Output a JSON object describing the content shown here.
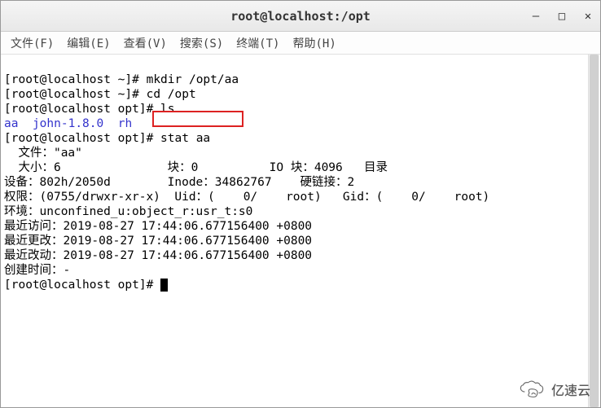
{
  "window": {
    "title": "root@localhost:/opt",
    "controls": {
      "minimize": "—",
      "maximize": "□",
      "close": "✕"
    }
  },
  "menubar": {
    "items": [
      "文件(F)",
      "编辑(E)",
      "查看(V)",
      "搜索(S)",
      "终端(T)",
      "帮助(H)"
    ]
  },
  "terminal": {
    "lines": [
      "[root@localhost ~]# mkdir /opt/aa",
      "[root@localhost ~]# cd /opt",
      "[root@localhost opt]# ls"
    ],
    "ls_output": {
      "aa": "aa",
      "john": "john-1.8.0",
      "rh": "rh"
    },
    "line_stat": "[root@localhost opt]# stat aa",
    "stat_output": [
      "  文件：\"aa\"",
      "  大小：6               块：0          IO 块：4096   目录",
      "设备：802h/2050d        Inode：34862767    硬链接：2",
      "权限：(0755/drwxr-xr-x)  Uid：(    0/    root)   Gid：(    0/    root)",
      "环境：unconfined_u:object_r:usr_t:s0",
      "最近访问：2019-08-27 17:44:06.677156400 +0800",
      "最近更改：2019-08-27 17:44:06.677156400 +0800",
      "最近改动：2019-08-27 17:44:06.677156400 +0800",
      "创建时间：-"
    ],
    "prompt_final": "[root@localhost opt]# "
  },
  "watermark": {
    "text": "亿速云"
  }
}
